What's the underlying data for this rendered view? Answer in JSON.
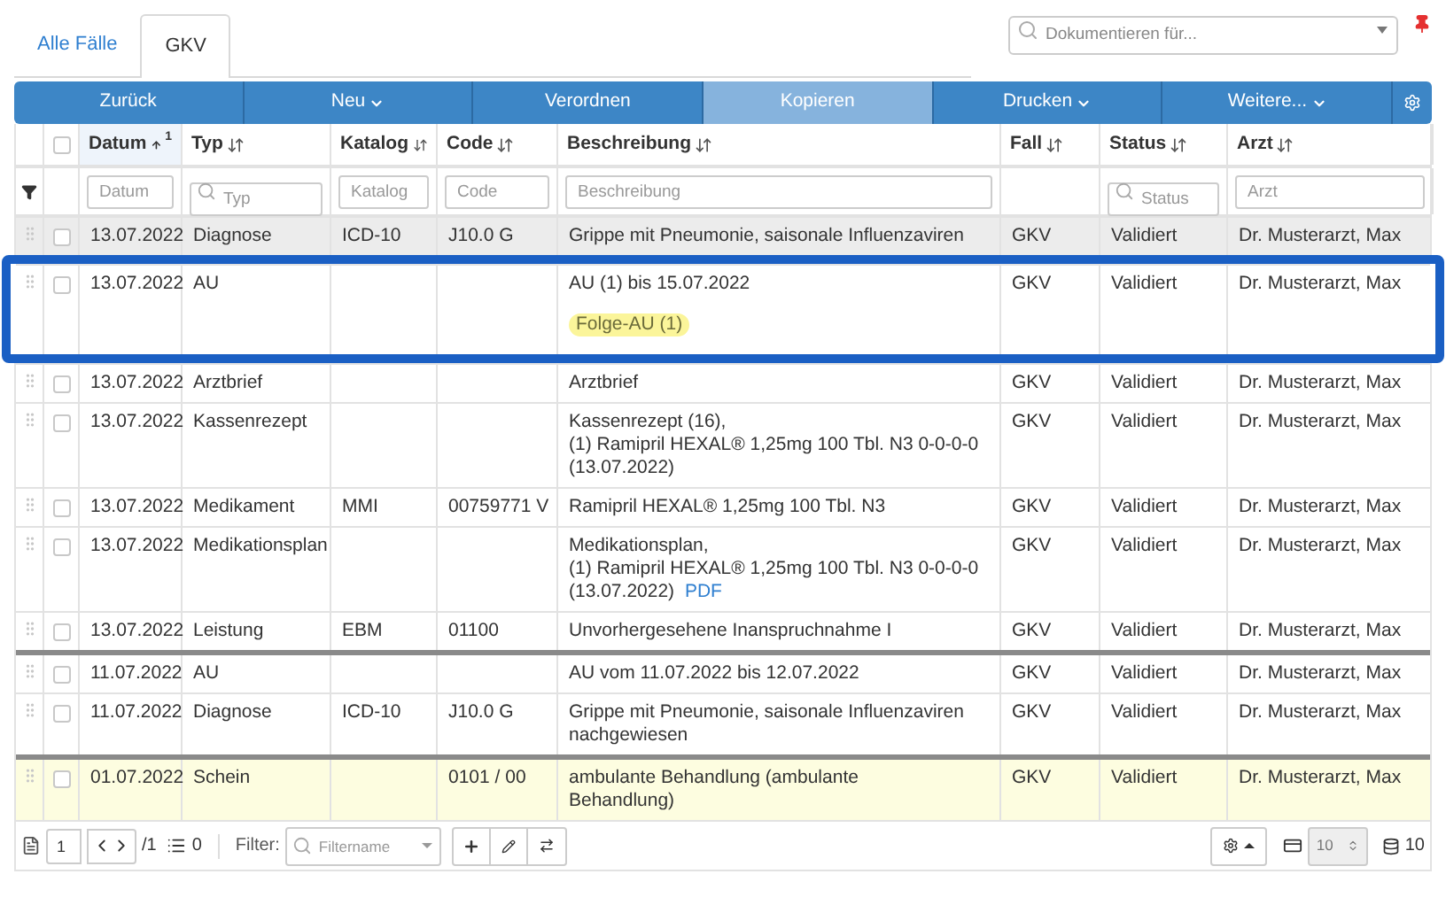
{
  "tabs": [
    {
      "label": "Alle Fälle",
      "selected": false
    },
    {
      "label": "GKV",
      "selected": true
    }
  ],
  "document_search": {
    "placeholder": "Dokumentieren für..."
  },
  "toolbar": [
    {
      "label": "Zurück",
      "dropdown": false,
      "selected": false
    },
    {
      "label": "Neu",
      "dropdown": true,
      "selected": false
    },
    {
      "label": "Verordnen",
      "dropdown": false,
      "selected": false
    },
    {
      "label": "Kopieren",
      "dropdown": false,
      "selected": true
    },
    {
      "label": "Drucken",
      "dropdown": true,
      "selected": false
    },
    {
      "label": "Weitere...",
      "dropdown": true,
      "selected": false
    }
  ],
  "select_all": {
    "checked": false
  },
  "columns": [
    {
      "label": "Datum",
      "sorted": true,
      "sort_rank": "1",
      "filter": {
        "kind": "text",
        "placeholder": "Datum"
      }
    },
    {
      "label": "Typ",
      "sorted": false,
      "filter": {
        "kind": "search",
        "placeholder": "Typ"
      }
    },
    {
      "label": "Katalog",
      "sorted": false,
      "filter": {
        "kind": "text",
        "placeholder": "Katalog"
      }
    },
    {
      "label": "Code",
      "sorted": false,
      "filter": {
        "kind": "text",
        "placeholder": "Code"
      }
    },
    {
      "label": "Beschreibung",
      "sorted": false,
      "filter": {
        "kind": "text",
        "placeholder": "Beschreibung"
      }
    },
    {
      "label": "Fall",
      "sorted": false,
      "filter": {
        "kind": "none"
      }
    },
    {
      "label": "Status",
      "sorted": false,
      "filter": {
        "kind": "search",
        "placeholder": "Status"
      }
    },
    {
      "label": "Arzt",
      "sorted": false,
      "filter": {
        "kind": "text",
        "placeholder": "Arzt"
      }
    }
  ],
  "rows": [
    {
      "kind": "normal",
      "checked": false,
      "separator_above": false,
      "highlighted": false,
      "shaded": true,
      "cells": [
        "13.07.2022",
        "Diagnose",
        "ICD-10",
        "J10.0 G"
      ],
      "description": [
        "Grippe mit Pneumonie, saisonale Influenzaviren"
      ],
      "fall": "GKV",
      "status": "Validiert",
      "arzt": "Dr. Musterarzt, Max"
    },
    {
      "kind": "callout",
      "checked": false,
      "separator_above": false,
      "highlighted": false,
      "shaded": false,
      "cells": [
        "13.07.2022",
        "AU",
        "",
        ""
      ],
      "description": [
        "AU (1) bis 15.07.2022"
      ],
      "tag": "Folge-AU (1)",
      "fall": "GKV",
      "status": "Validiert",
      "arzt": "Dr. Musterarzt, Max"
    },
    {
      "kind": "normal",
      "checked": false,
      "separator_above": false,
      "highlighted": false,
      "shaded": false,
      "cells": [
        "13.07.2022",
        "Arztbrief",
        "",
        ""
      ],
      "description": [
        "Arztbrief"
      ],
      "fall": "GKV",
      "status": "Validiert",
      "arzt": "Dr. Musterarzt, Max"
    },
    {
      "kind": "normal",
      "checked": false,
      "separator_above": false,
      "highlighted": false,
      "shaded": false,
      "cells": [
        "13.07.2022",
        "Kassenrezept",
        "",
        ""
      ],
      "description": [
        "Kassenrezept (16),",
        "(1) Ramipril HEXAL® 1,25mg 100 Tbl. N3 0-0-0-0",
        "(13.07.2022)"
      ],
      "fall": "GKV",
      "status": "Validiert",
      "arzt": "Dr. Musterarzt, Max"
    },
    {
      "kind": "normal",
      "checked": false,
      "separator_above": false,
      "highlighted": false,
      "shaded": false,
      "cells": [
        "13.07.2022",
        "Medikament",
        "MMI",
        "00759771 V"
      ],
      "description": [
        "Ramipril HEXAL® 1,25mg 100 Tbl. N3"
      ],
      "fall": "GKV",
      "status": "Validiert",
      "arzt": "Dr. Musterarzt, Max"
    },
    {
      "kind": "normal",
      "checked": false,
      "separator_above": false,
      "highlighted": false,
      "shaded": false,
      "cells": [
        "13.07.2022",
        "Medikationsplan",
        "",
        ""
      ],
      "description": [
        "Medikationsplan,",
        "(1) Ramipril HEXAL® 1,25mg 100 Tbl. N3 0-0-0-0",
        "(13.07.2022)"
      ],
      "link": "PDF",
      "fall": "GKV",
      "status": "Validiert",
      "arzt": "Dr. Musterarzt, Max"
    },
    {
      "kind": "normal",
      "checked": false,
      "separator_above": false,
      "highlighted": false,
      "shaded": false,
      "cells": [
        "13.07.2022",
        "Leistung",
        "EBM",
        "01100"
      ],
      "description": [
        "Unvorhergesehene Inanspruchnahme I"
      ],
      "fall": "GKV",
      "status": "Validiert",
      "arzt": "Dr. Musterarzt, Max"
    },
    {
      "kind": "normal",
      "checked": false,
      "separator_above": true,
      "highlighted": false,
      "shaded": false,
      "cells": [
        "11.07.2022",
        "AU",
        "",
        ""
      ],
      "description": [
        "AU vom 11.07.2022 bis 12.07.2022"
      ],
      "fall": "GKV",
      "status": "Validiert",
      "arzt": "Dr. Musterarzt, Max"
    },
    {
      "kind": "normal",
      "checked": false,
      "separator_above": false,
      "highlighted": false,
      "shaded": false,
      "cells": [
        "11.07.2022",
        "Diagnose",
        "ICD-10",
        "J10.0 G"
      ],
      "description": [
        "Grippe mit Pneumonie, saisonale Influenzaviren",
        "nachgewiesen"
      ],
      "fall": "GKV",
      "status": "Validiert",
      "arzt": "Dr. Musterarzt, Max"
    },
    {
      "kind": "normal",
      "checked": false,
      "separator_above": true,
      "highlighted": true,
      "shaded": false,
      "cells": [
        "01.07.2022",
        "Schein",
        "",
        "0101 / 00"
      ],
      "description": [
        "ambulante Behandlung (ambulante",
        "Behandlung)"
      ],
      "fall": "GKV",
      "status": "Validiert",
      "arzt": "Dr. Musterarzt, Max"
    }
  ],
  "footer": {
    "page": "1",
    "page_total": "/1",
    "selected_count": "0",
    "filter_label": "Filter:",
    "filter_placeholder": "Filtername",
    "page_size": "10",
    "total": "10"
  }
}
